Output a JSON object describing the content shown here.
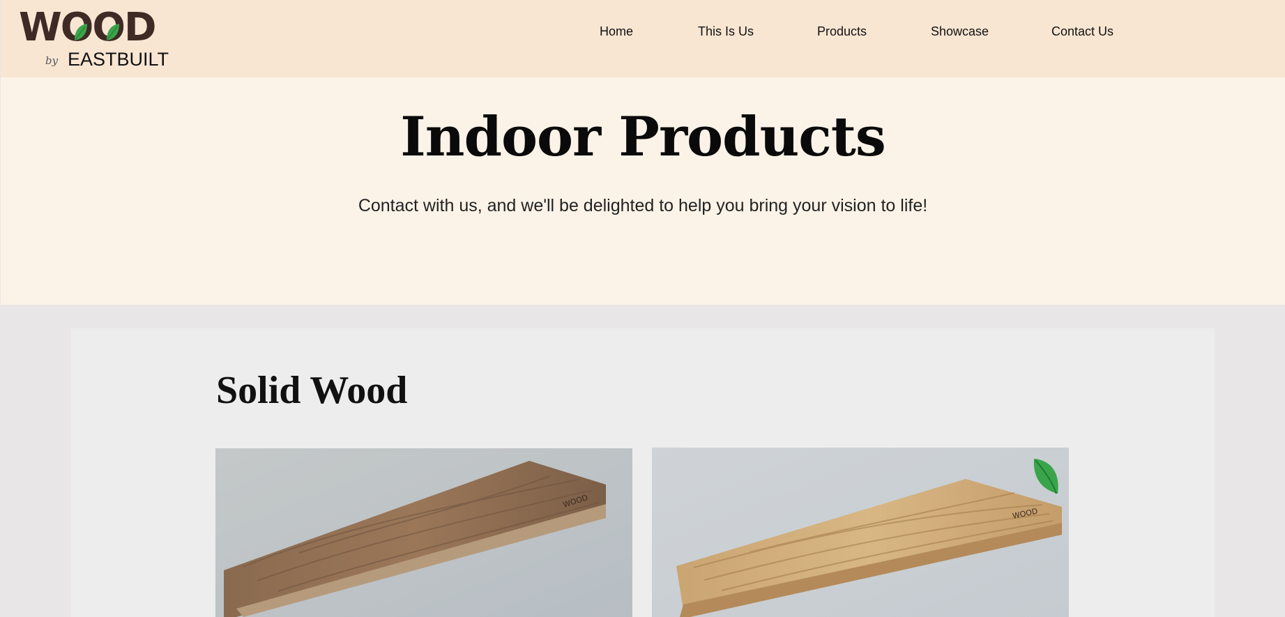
{
  "brand": {
    "logo_word": "WOOD",
    "logo_by": "by",
    "logo_company": "EASTBUILT",
    "leaf_color": "#3aa44a",
    "logo_color": "#3f2a25"
  },
  "nav": {
    "items": [
      {
        "label": "Home"
      },
      {
        "label": "This Is Us"
      },
      {
        "label": "Products"
      },
      {
        "label": "Showcase"
      },
      {
        "label": "Contact Us"
      }
    ]
  },
  "hero": {
    "title": "Indoor Products",
    "subtitle": "Contact with us, and we'll be delighted to help you bring your vision to life!"
  },
  "section": {
    "title": "Solid Wood"
  },
  "products": [
    {
      "image": "dark-oak-plank-photo",
      "badge": ""
    },
    {
      "image": "light-oak-plank-photo",
      "badge": "leaf-icon"
    }
  ],
  "colors": {
    "header_bg": "#f8e6d3",
    "hero_bg": "#fcf3e8",
    "page_bg": "#e8e6e6",
    "card_bg": "#eeedee"
  }
}
